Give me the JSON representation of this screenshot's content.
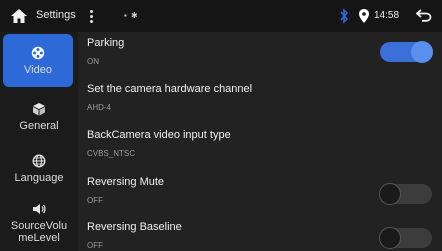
{
  "status_bar": {
    "title": "Settings",
    "indicator": "▪ ✱",
    "time": "14:58"
  },
  "sidebar": {
    "items": [
      {
        "label": "Video",
        "icon": "video-reel-icon",
        "active": true
      },
      {
        "label": "General",
        "icon": "box-icon",
        "active": false
      },
      {
        "label": "Language",
        "icon": "globe-icon",
        "active": false
      },
      {
        "label": "SourceVolumeLevel",
        "icon": "speaker-icon",
        "active": false
      }
    ]
  },
  "settings": [
    {
      "title": "Parking",
      "value": "ON",
      "toggle": "on"
    },
    {
      "title": "Set the camera hardware channel",
      "value": "AHD-4"
    },
    {
      "title": "BackCamera video input type",
      "value": "CVBS_NTSC"
    },
    {
      "title": "Reversing Mute",
      "value": "OFF",
      "toggle": "off"
    },
    {
      "title": "Reversing Baseline",
      "value": "OFF",
      "toggle": "off"
    }
  ],
  "colors": {
    "accent": "#2d6ad8",
    "toggle_on": "#3b6fd9",
    "background": "#1f1f1f"
  }
}
